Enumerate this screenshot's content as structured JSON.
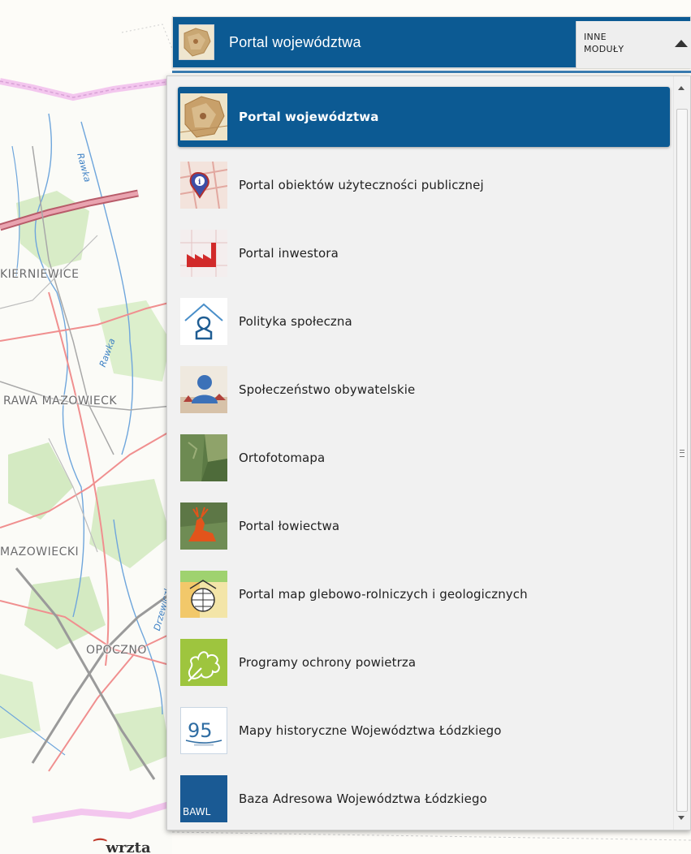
{
  "header": {
    "title": "Portal województwa",
    "modules_line1": "INNE",
    "modules_line2": "MODUŁY"
  },
  "map": {
    "labels": [
      "KIERNIEWICE",
      "RAWA MAZOWIECK",
      "MAZOWIECKI",
      "OPOCZNO"
    ],
    "rivers": [
      "Rawka",
      "Rawka",
      "Drzewiczka"
    ],
    "logo_text": "wrzta"
  },
  "menu": {
    "items": [
      {
        "label": "Portal województwa",
        "icon": "region-map-thumbnail-icon",
        "active": true
      },
      {
        "label": "Portal obiektów użyteczności publicznej",
        "icon": "info-pin-icon",
        "active": false
      },
      {
        "label": "Portal inwestora",
        "icon": "factory-icon",
        "active": false
      },
      {
        "label": "Polityka społeczna",
        "icon": "house-person-icon",
        "active": false
      },
      {
        "label": "Społeczeństwo obywatelskie",
        "icon": "citizen-silhouette-icon",
        "active": false
      },
      {
        "label": "Ortofotomapa",
        "icon": "aerial-photo-icon",
        "active": false
      },
      {
        "label": "Portal łowiectwa",
        "icon": "deer-icon",
        "active": false
      },
      {
        "label": "Portal map glebowo-rolniczych i geologicznych",
        "icon": "soil-globe-icon",
        "active": false
      },
      {
        "label": "Programy ochrony powietrza",
        "icon": "oak-leaf-icon",
        "active": false
      },
      {
        "label": "Mapy historyczne Województwa Łódzkiego",
        "icon": "historical-95-icon",
        "icon_text": "95",
        "active": false
      },
      {
        "label": "Baza Adresowa Województwa Łódzkiego",
        "icon": "bawl-logo-icon",
        "icon_text": "BAWL",
        "active": false
      }
    ]
  },
  "colors": {
    "header_bg": "#0c5a93",
    "active_item_bg": "#0c5a93",
    "panel_bg": "#f1f1f1"
  }
}
